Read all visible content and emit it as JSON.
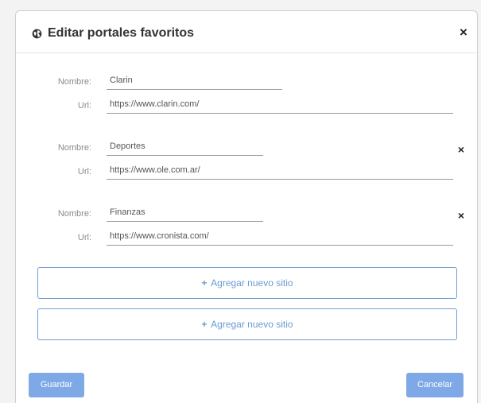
{
  "dialog": {
    "title": "Editar portales favoritos",
    "close_symbol": "×",
    "icon": "globe-icon"
  },
  "labels": {
    "name": "Nombre:",
    "url": "Url:"
  },
  "sites": [
    {
      "name": "Clarin",
      "url": "https://www.clarin.com/",
      "removable": false
    },
    {
      "name": "Deportes",
      "url": "https://www.ole.com.ar/",
      "removable": true
    },
    {
      "name": "Finanzas",
      "url": "https://www.cronista.com/",
      "removable": true
    }
  ],
  "remove_symbol": "×",
  "add_buttons": [
    {
      "plus": "+",
      "label": "Agregar nuevo sitio"
    },
    {
      "plus": "+",
      "label": "Agregar nuevo sitio"
    }
  ],
  "footer": {
    "save_label": "Guardar",
    "cancel_label": "Cancelar"
  },
  "colors": {
    "accent": "#7fa9e6",
    "add_border": "#6f9fd6"
  }
}
